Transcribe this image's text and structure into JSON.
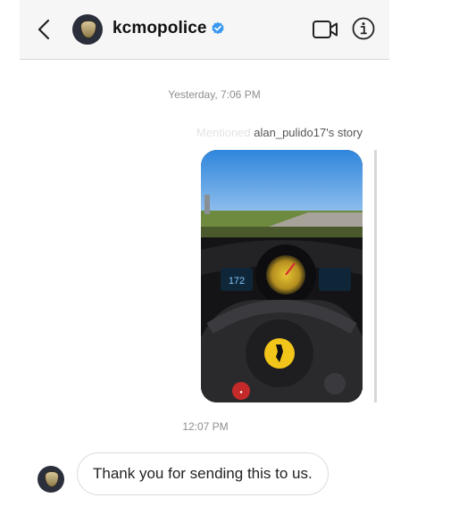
{
  "header": {
    "username": "kcmopolice",
    "verified": true,
    "icons": [
      "back-chevron-icon",
      "video-call-icon",
      "info-icon",
      "verified-badge-icon"
    ]
  },
  "thread": {
    "timestamp_1": "Yesterday, 7:06 PM",
    "story_prefix": "Mentioned",
    "story_label": "alan_pulido17's story",
    "story_speedometer": "172",
    "timestamp_2": "12:07 PM",
    "message": "Thank you for sending this to us."
  },
  "colors": {
    "accent_verified": "#3897f0",
    "header_bg": "#f6f6f6",
    "timestamp_gray": "#8e8e8e"
  }
}
